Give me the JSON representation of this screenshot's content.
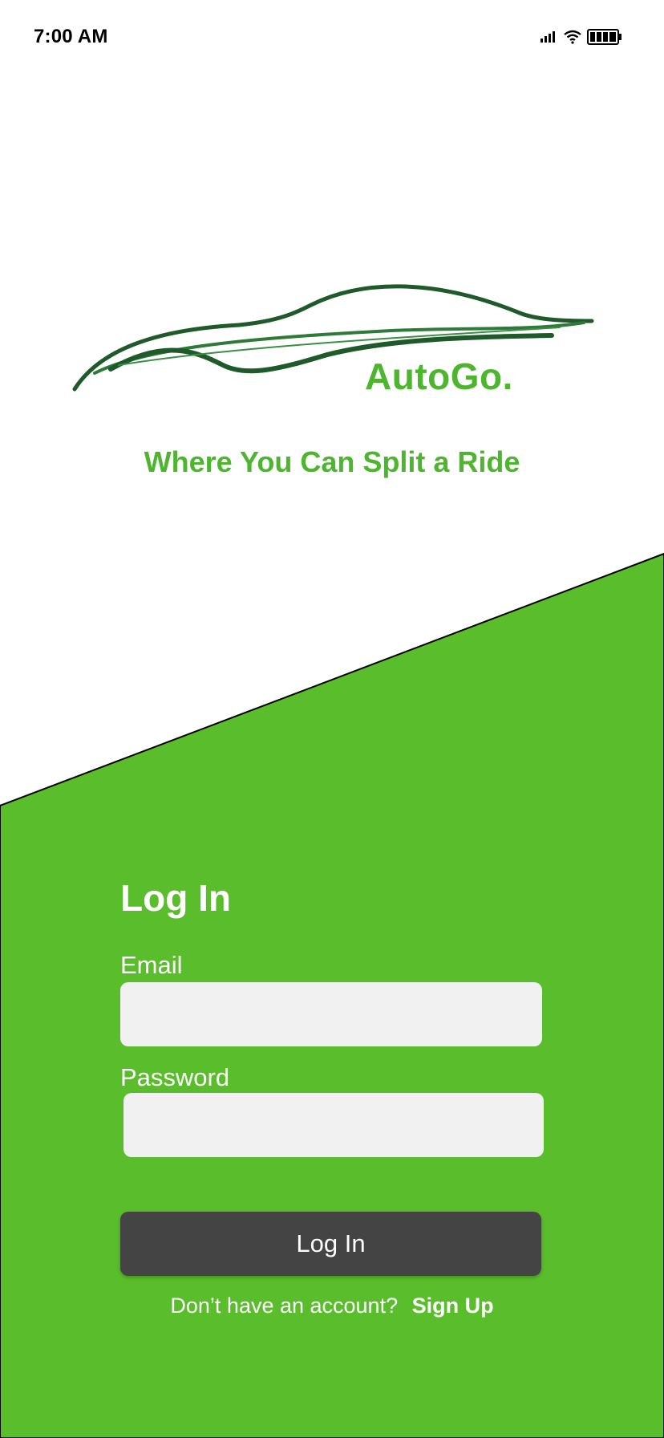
{
  "status_bar": {
    "time": "7:00 AM",
    "icons": [
      "signal-icon",
      "wifi-icon",
      "battery-icon"
    ]
  },
  "brand": {
    "name": "AutoGo.",
    "tagline": "Where You Can Split a Ride",
    "logo_icon": "car-silhouette-icon"
  },
  "login": {
    "title": "Log In",
    "email_label": "Email",
    "email_value": "",
    "password_label": "Password",
    "password_value": "",
    "submit_label": "Log In",
    "no_account_text": "Don’t have an account?",
    "signup_label": "Sign Up"
  },
  "colors": {
    "brand_green": "#4db52e",
    "panel_green": "#5abd2b",
    "button_dark": "#444444",
    "input_bg": "#f2f1f1",
    "logo_dark_green": "#1f5a2a"
  }
}
